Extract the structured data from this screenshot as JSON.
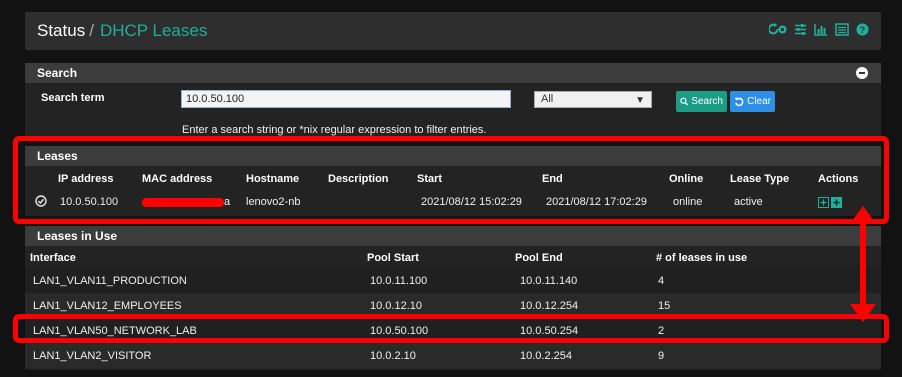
{
  "header": {
    "section": "Status",
    "separator": "/",
    "page": "DHCP Leases"
  },
  "search_panel": {
    "title": "Search",
    "term_label": "Search term",
    "term_value": "10.0.50.100",
    "filter_selected": "All",
    "search_button": "Search",
    "clear_button": "Clear",
    "help": "Enter a search string or *nix regular expression to filter entries."
  },
  "leases": {
    "title": "Leases",
    "columns": [
      "IP address",
      "MAC address",
      "Hostname",
      "Description",
      "Start",
      "End",
      "Online",
      "Lease Type",
      "Actions"
    ],
    "rows": [
      {
        "ip": "10.0.50.100",
        "mac_tail": "a",
        "hostname": "lenovo2-nb",
        "description": "",
        "start": "2021/08/12 15:02:29",
        "end": "2021/08/12 17:02:29",
        "online": "online",
        "type": "active"
      }
    ]
  },
  "leases_in_use": {
    "title": "Leases in Use",
    "columns": [
      "Interface",
      "Pool Start",
      "Pool End",
      "# of leases in use"
    ],
    "rows": [
      {
        "iface": "LAN1_VLAN11_PRODUCTION",
        "start": "10.0.11.100",
        "end": "10.0.11.140",
        "count": "4"
      },
      {
        "iface": "LAN1_VLAN12_EMPLOYEES",
        "start": "10.0.12.10",
        "end": "10.0.12.254",
        "count": "15"
      },
      {
        "iface": "LAN1_VLAN50_NETWORK_LAB",
        "start": "10.0.50.100",
        "end": "10.0.50.254",
        "count": "2"
      },
      {
        "iface": "LAN1_VLAN2_VISITOR",
        "start": "10.0.2.10",
        "end": "10.0.2.254",
        "count": "9"
      }
    ]
  },
  "colors": {
    "accent": "#1fb09a",
    "annotation": "#ff0000",
    "search_btn": "#1b9c86",
    "clear_btn": "#2d8fe6"
  }
}
